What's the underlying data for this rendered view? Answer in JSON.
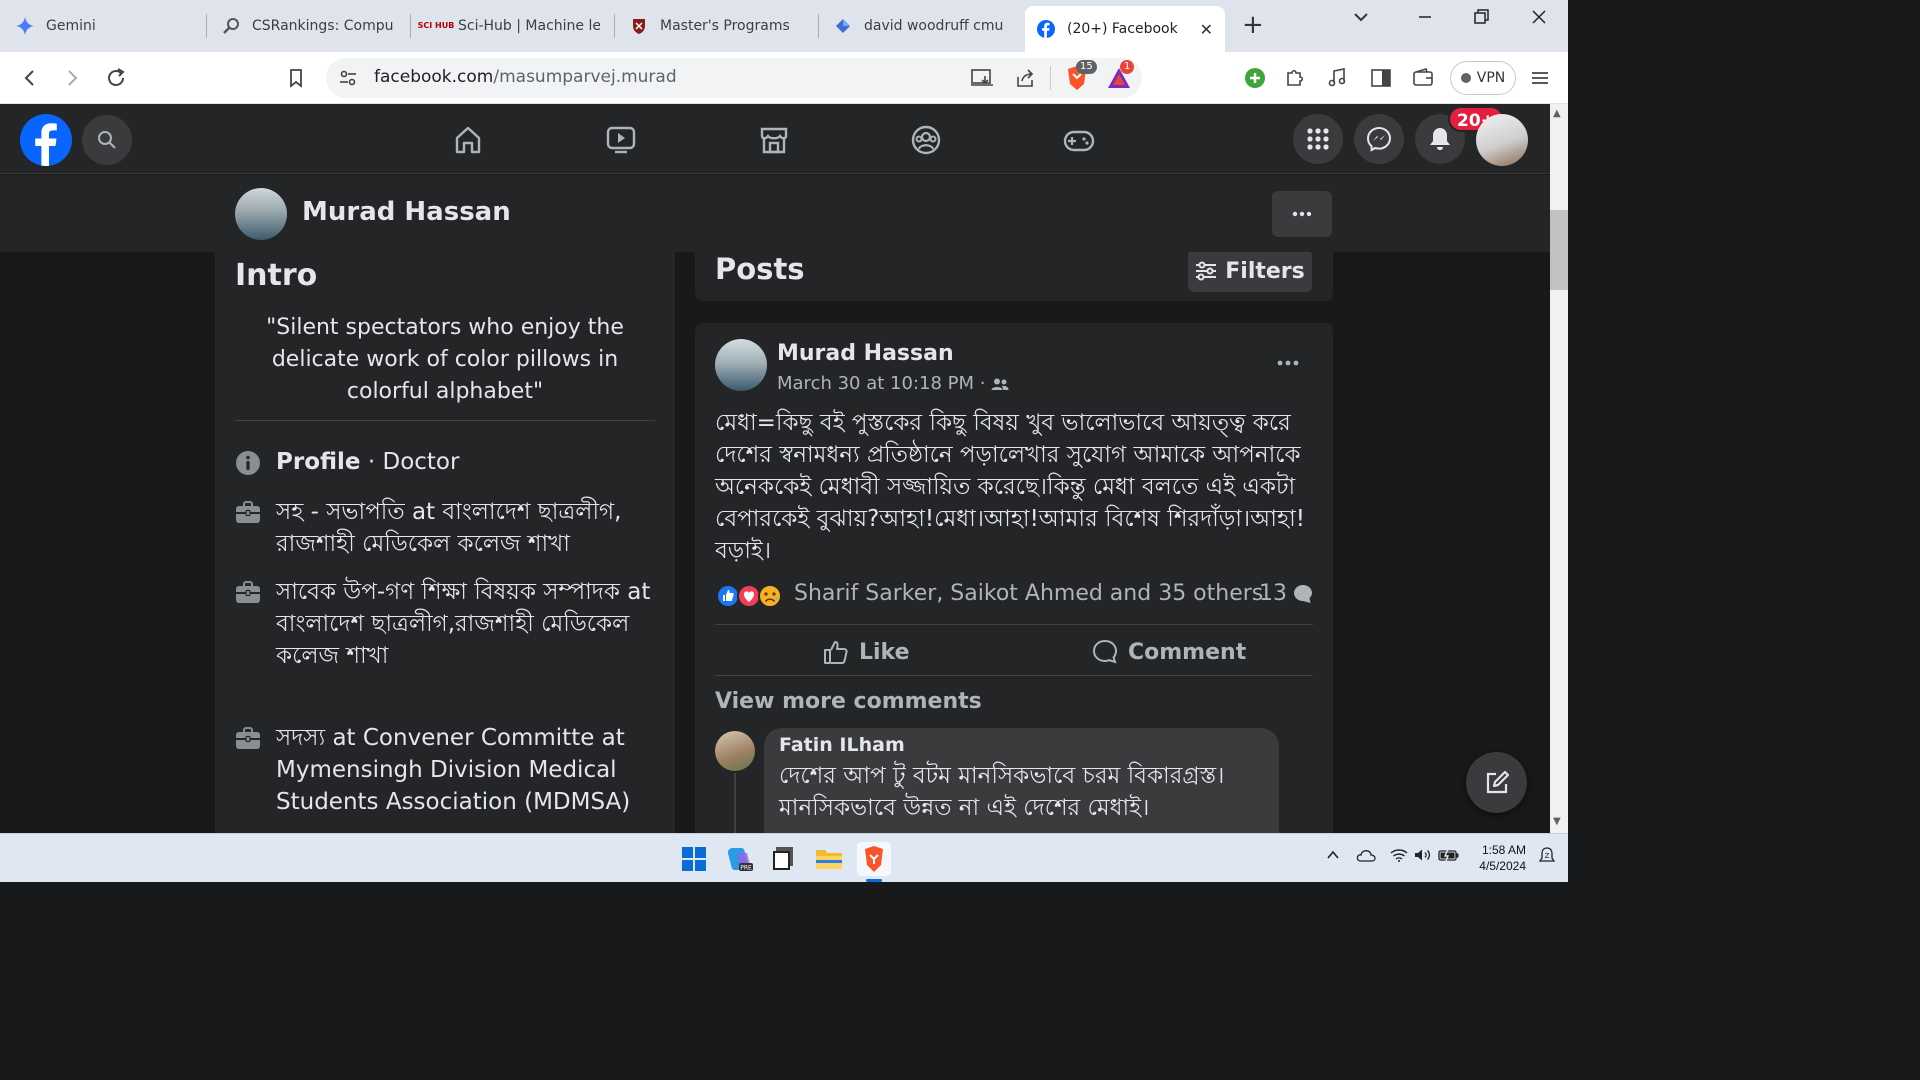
{
  "browser": {
    "tabs": [
      {
        "title": "Gemini",
        "icon": "gemini-sparkle-icon"
      },
      {
        "title": "CSRankings: Compute",
        "icon": "magnifier-icon"
      },
      {
        "title": "Sci-Hub | Machine lea",
        "icon": "scihub-icon",
        "icon_text": "SCI HUB"
      },
      {
        "title": "Master's Programs",
        "icon": "university-crest-icon"
      },
      {
        "title": "david woodruff cmu",
        "icon": "diamond-icon"
      },
      {
        "title": "(20+) Facebook",
        "icon": "facebook-icon",
        "active": true
      }
    ],
    "new_tab_label": "+",
    "url_domain": "facebook.com",
    "url_path": "/masumparvej.murad",
    "brave_shield_count": "15",
    "brave_rewards_count": "1",
    "vpn_label": "VPN"
  },
  "facebook": {
    "notifications_badge": "20+",
    "profile_name": "Murad Hassan",
    "intro": {
      "title": "Intro",
      "bio": "\"Silent spectators who enjoy the delicate work of color pillows in colorful alphabet\"",
      "profile_label": "Profile",
      "profile_value": " · Doctor",
      "items": [
        "সহ - সভাপতি at বাংলাদেশ ছাত্রলীগ, রাজশাহী মেডিকেল কলেজ শাখা",
        "সাবেক উপ-গণ শিক্ষা বিষয়ক সম্পাদক at বাংলাদেশ ছাত্রলীগ,রাজশাহী মেডিকেল কলেজ শাখা",
        "সদস্য at Convener Committe at Mymensingh Division Medical Students Association (MDMSA)"
      ]
    },
    "posts": {
      "title": "Posts",
      "filters_label": "Filters"
    },
    "post": {
      "author": "Murad Hassan",
      "time": "March 30 at 10:18 PM · ",
      "text": "মেধা=কিছু বই পুস্তকের কিছু বিষয় খুব ভালোভাবে আয়ত্ত্ব করে দেশের স্বনামধন্য প্রতিষ্ঠানে পড়ালেখার সুযোগ আমাকে আপনাকে অনেককেই মেধাবী সজ্জায়িত করেছে।কিন্তু মেধা বলতে এই একটা বেপারকেই বুঝায়?আহা!মেধা।আহা!আমার বিশেষ শিরদাঁড়া।আহা!বড়াই।",
      "reactions_text": "Sharif Sarker, Saikot Ahmed and 35 others",
      "comment_count": "13",
      "like_label": "Like",
      "comment_label": "Comment",
      "view_more_comments": "View more comments",
      "comment": {
        "author": "Fatin ILham",
        "text": "দেশের আপ টু বটম মানসিকভাবে চরম বিকারগ্রস্ত। মানসিকভাবে উন্নত না এই দেশের মেধাই।"
      }
    }
  },
  "taskbar": {
    "time": "1:58 AM",
    "date": "4/5/2024"
  },
  "colors": {
    "facebook_blue": "#0866ff",
    "fb_card": "#242526",
    "fb_bg": "#18191a",
    "notification_red": "#e41e3f"
  }
}
